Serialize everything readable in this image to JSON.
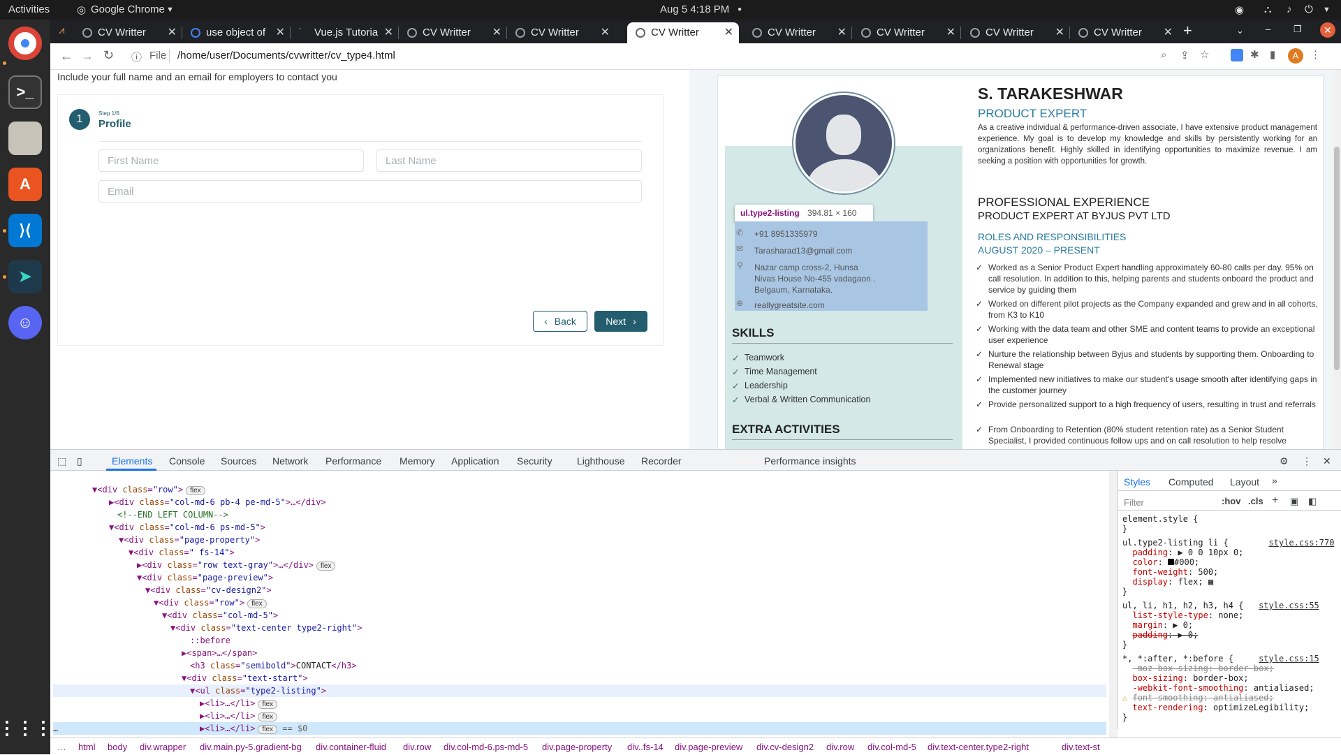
{
  "topbar": {
    "activities": "Activities",
    "app": "Google Chrome",
    "clock": "Aug 5  4:18 PM"
  },
  "tabs": [
    {
      "label": "CV Writter"
    },
    {
      "label": "use object of"
    },
    {
      "label": "Vue.js Tutoria"
    },
    {
      "label": "CV Writter"
    },
    {
      "label": "CV Writter"
    },
    {
      "label": "CV Writter"
    },
    {
      "label": "CV Writter"
    },
    {
      "label": "CV Writter"
    },
    {
      "label": "CV Writter"
    },
    {
      "label": "CV Writter"
    }
  ],
  "address": {
    "scheme_label": "File",
    "url": "/home/user/Documents/cvwritter/cv_type4.html",
    "profile_initial": "A"
  },
  "form": {
    "intro": "Include your full name and an email for employers to contact you",
    "step_number": "1",
    "step_small": "Step 1/6",
    "step_title": "Profile",
    "first_name_placeholder": "First Name",
    "last_name_placeholder": "Last Name",
    "email_placeholder": "Email",
    "back": "Back",
    "next": "Next"
  },
  "cv": {
    "name": "S. TARAKESHWAR",
    "role": "PRODUCT EXPERT",
    "summary": "As a creative individual & performance-driven associate, I have extensive product management experience. My goal is to develop my knowledge and skills by persistently working for an organizations benefit. Highly skilled in identifying opportunities to maximize revenue. I am seeking a position with opportunities for growth.",
    "tooltip_name": "ul.type2-listing",
    "tooltip_size": "394.81 × 160",
    "phone": "+91 8951335979",
    "email": "Tarasharad13@gmail.com",
    "address1": "Nazar camp cross-2, Hunsa",
    "address2": "Nivas House No-455 vadagaon .",
    "address3": "Belgaum, Karnataka.",
    "site": "reallygreatsite.com",
    "skills_title": "SKILLS",
    "skills": [
      "Teamwork",
      "Time Management",
      "Leadership",
      "Verbal & Written Communication"
    ],
    "extra_title": "EXTRA ACTIVITIES",
    "exp_title": "PROFESSIONAL EXPERIENCE",
    "exp_company": "PRODUCT EXPERT AT BYJUS PVT LTD",
    "roles": "ROLES AND RESPONSIBILITIES",
    "period": "AUGUST 2020 – PRESENT",
    "bullets": [
      "Worked as a Senior Product Expert handling approximately 60-80 calls per day. 95% on call resolution. In addition to this, helping parents and students onboard the product and service by guiding them",
      "Worked on different pilot projects as the Company expanded and grew and in all cohorts, from K3 to K10",
      "Working with the data team and other SME and content teams to provide an exceptional user experience",
      "Nurture the relationship between Byjus and students by supporting them. Onboarding to Renewal stage",
      "Implemented new initiatives to make our student's usage smooth after identifying gaps in the customer journey",
      "Provide personalized support to a high frequency of users, resulting in trust and referrals",
      "From Onboarding to Retention (80% student retention rate) as a Senior Student Specialist, I provided continuous follow ups and on call resolution to help resolve"
    ]
  },
  "devtools": {
    "tabs": [
      "Elements",
      "Console",
      "Sources",
      "Network",
      "Performance",
      "Memory",
      "Application",
      "Security",
      "Lighthouse",
      "Recorder",
      "Performance insights"
    ],
    "side_tabs": [
      "Styles",
      "Computed",
      "Layout"
    ],
    "filter_placeholder": "Filter",
    "hov": ":hov",
    "cls": ".cls",
    "crumbs": [
      "html",
      "body",
      "div.wrapper",
      "div.main.py-5.gradient-bg",
      "div.container-fluid",
      "div.row",
      "div.col-md-6.ps-md-5",
      "div.page-property",
      "div..fs-14",
      "div.page-preview",
      "div.cv-design2",
      "div.row",
      "div.col-md-5",
      "div.text-center.type2-right",
      "div.text-st"
    ]
  }
}
